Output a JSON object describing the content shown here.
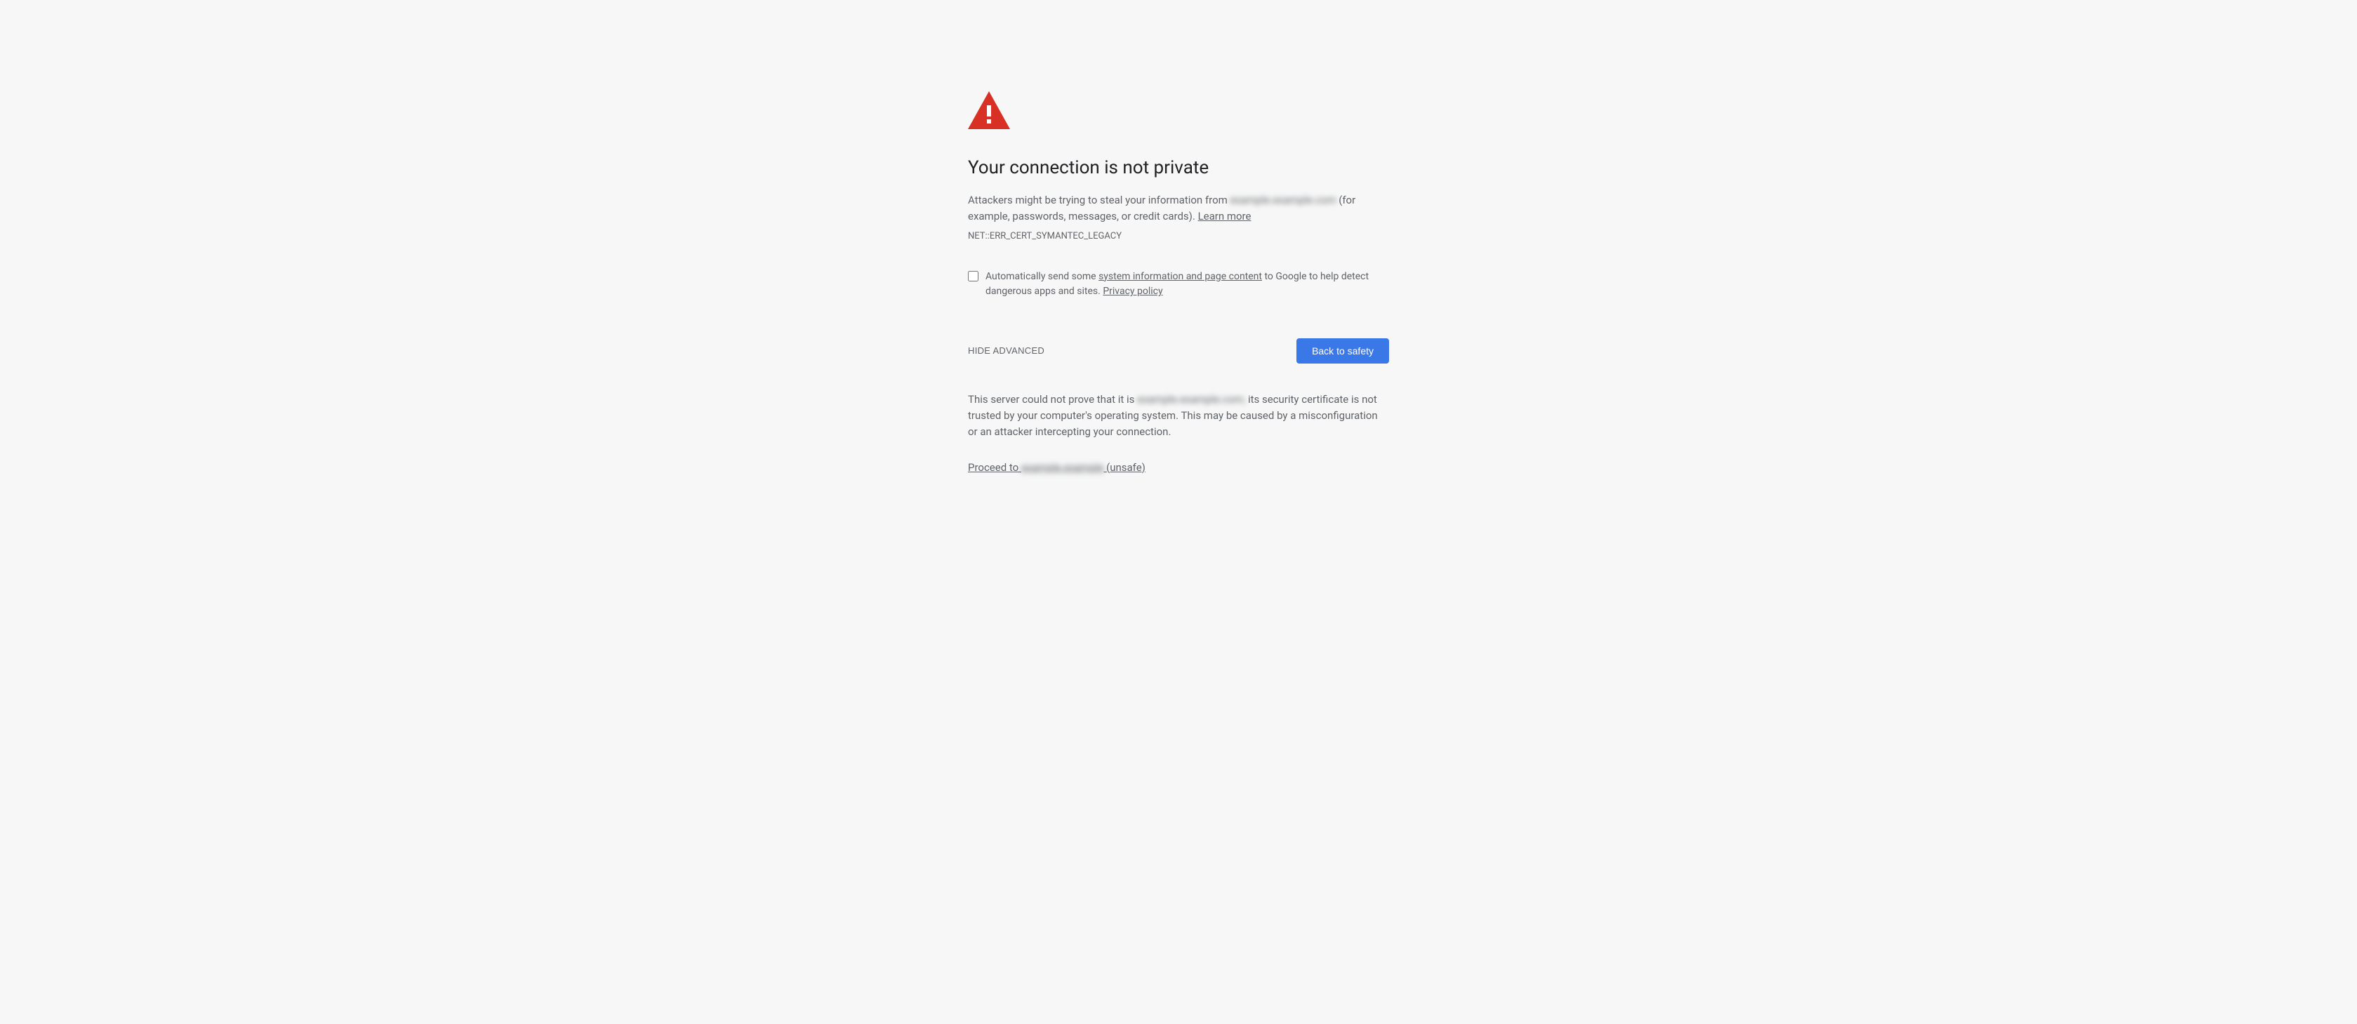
{
  "title": "Your connection is not private",
  "body": {
    "prefix": "Attackers might be trying to steal your information from ",
    "host_obscured": "example.example.com",
    "suffix": " (for example, passwords, messages, or credit cards). ",
    "learn_more": "Learn more"
  },
  "error_code": "NET::ERR_CERT_SYMANTEC_LEGACY",
  "opt_in": {
    "prefix": "Automatically send some ",
    "link1": "system information and page content",
    "middle": " to Google to help detect dangerous apps and sites. ",
    "link2": "Privacy policy"
  },
  "buttons": {
    "hide_advanced": "HIDE ADVANCED",
    "back_to_safety": "Back to safety"
  },
  "advanced": {
    "prefix": "This server could not prove that it is ",
    "host_obscured": "example.example.com;",
    "suffix": " its security certificate is not trusted by your computer's operating system. This may be caused by a misconfiguration or an attacker intercepting your connection."
  },
  "proceed": {
    "prefix": "Proceed to ",
    "host_obscured": "example.example",
    "suffix": " (unsafe)"
  }
}
